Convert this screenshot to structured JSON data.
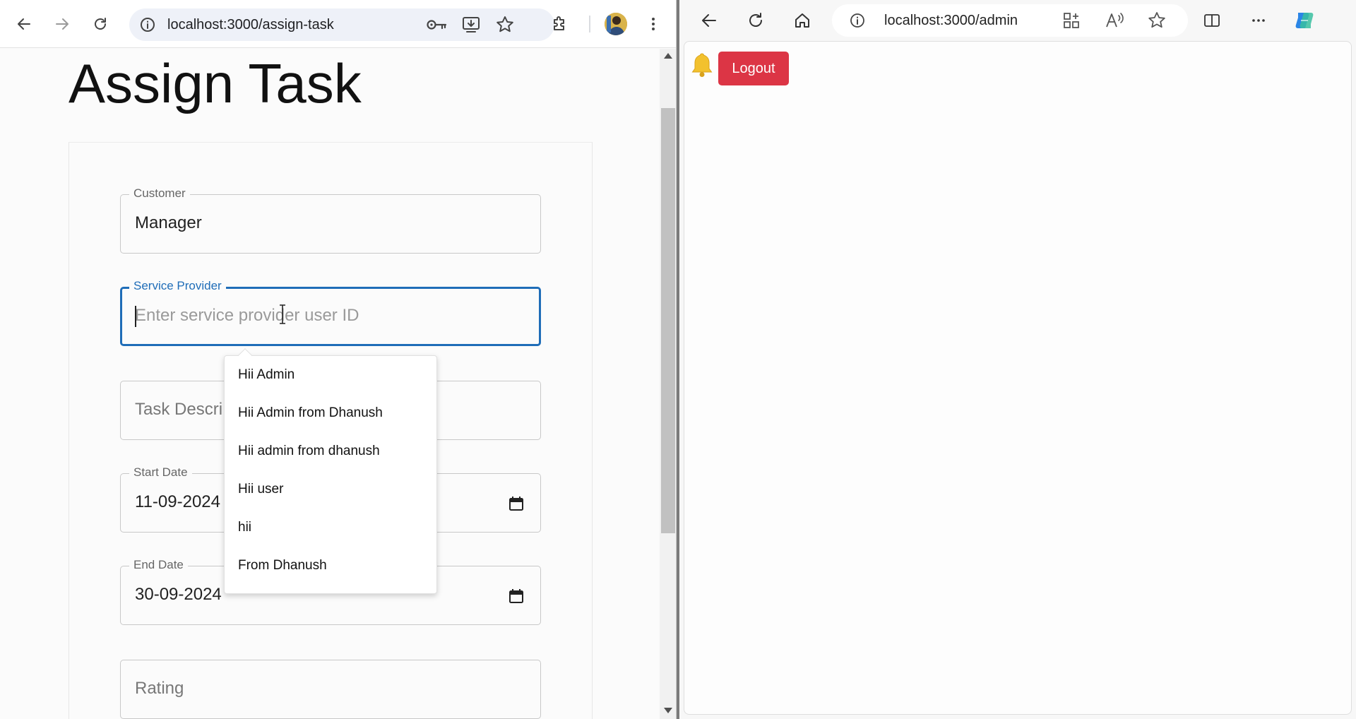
{
  "left_browser": {
    "url": "localhost:3000/assign-task",
    "icons": [
      "back-icon",
      "forward-icon",
      "reload-icon",
      "info-icon",
      "password-key-icon",
      "install-app-icon",
      "bookmark-star-icon",
      "extensions-icon",
      "profile-avatar",
      "more-menu-icon"
    ]
  },
  "page": {
    "title": "Assign Task",
    "fields": {
      "customer": {
        "label": "Customer",
        "value": "Manager"
      },
      "service_provider": {
        "label": "Service Provider",
        "placeholder": "Enter service provider user ID",
        "focused": true
      },
      "task_description": {
        "placeholder": "Task Descri"
      },
      "start_date": {
        "label": "Start Date",
        "value": "11-09-2024"
      },
      "end_date": {
        "label": "End Date",
        "value": "30-09-2024"
      },
      "rating": {
        "placeholder": "Rating"
      }
    },
    "autocomplete": {
      "options": [
        "Hii Admin",
        "Hii Admin from Dhanush",
        "Hii admin from dhanush",
        "Hii user",
        "hii",
        "From Dhanush"
      ]
    }
  },
  "right_browser": {
    "url": "localhost:3000/admin",
    "icons": [
      "back-icon",
      "reload-icon",
      "home-icon",
      "info-icon",
      "apps-icon",
      "read-aloud-icon",
      "favorites-star-icon",
      "split-screen-icon",
      "more-menu-icon",
      "copilot-icon"
    ]
  },
  "admin_page": {
    "logout_label": "Logout",
    "bell_icon": "bell-icon"
  },
  "colors": {
    "focus_blue": "#1f6db8",
    "logout_red": "#dc3545",
    "bell_yellow": "#f2c12e"
  }
}
